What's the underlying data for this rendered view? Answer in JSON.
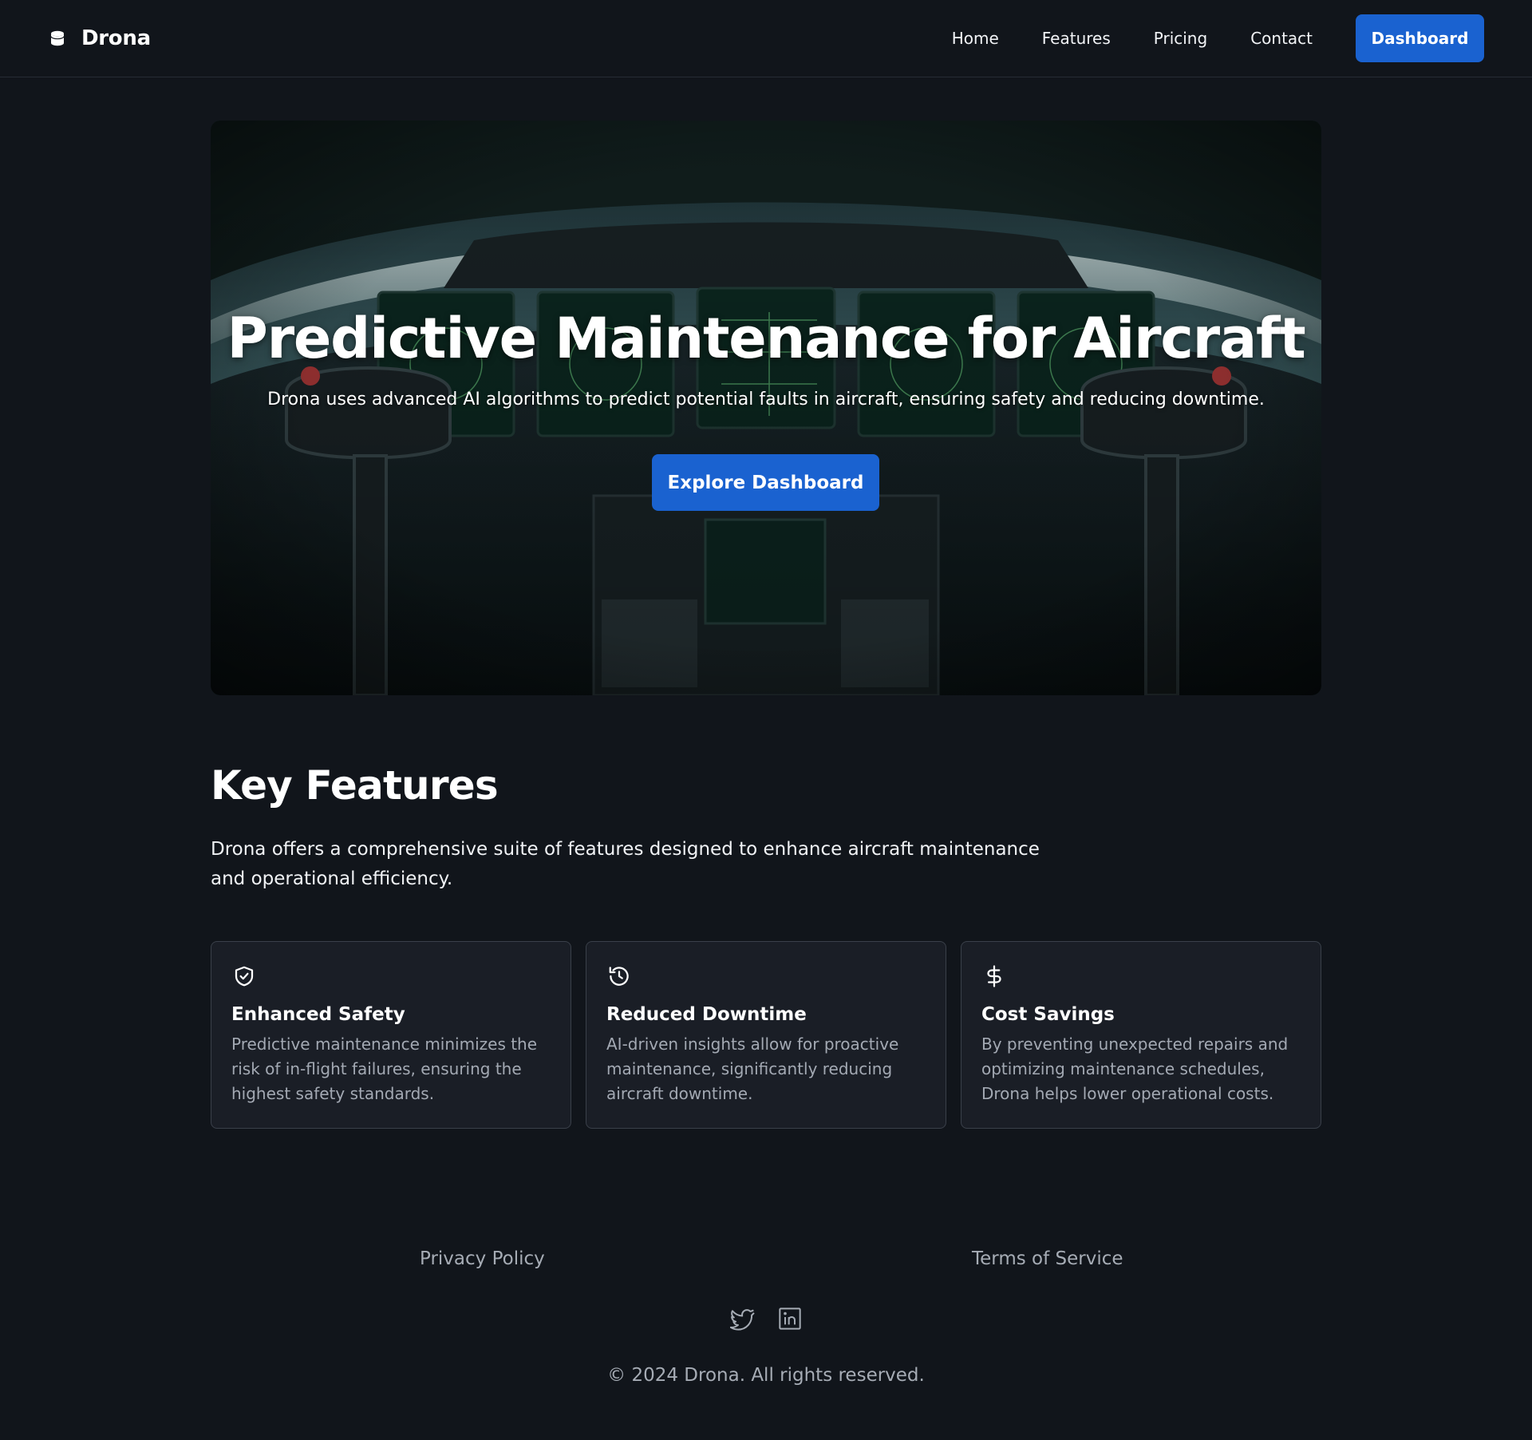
{
  "header": {
    "brand": "Drona",
    "nav": [
      "Home",
      "Features",
      "Pricing",
      "Contact"
    ],
    "cta": "Dashboard"
  },
  "hero": {
    "title": "Predictive Maintenance for Aircraft",
    "subtitle": "Drona uses advanced AI algorithms to predict potential faults in aircraft, ensuring safety and reducing downtime.",
    "button": "Explore Dashboard",
    "image_description": "aircraft-cockpit-photo"
  },
  "features": {
    "title": "Key Features",
    "description": "Drona offers a comprehensive suite of features designed to enhance aircraft maintenance and operational efficiency.",
    "cards": [
      {
        "icon": "shield-check-icon",
        "title": "Enhanced Safety",
        "text": "Predictive maintenance minimizes the risk of in-flight failures, ensuring the highest safety standards."
      },
      {
        "icon": "history-icon",
        "title": "Reduced Downtime",
        "text": "AI-driven insights allow for proactive maintenance, significantly reducing aircraft downtime."
      },
      {
        "icon": "dollar-icon",
        "title": "Cost Savings",
        "text": "By preventing unexpected repairs and optimizing maintenance schedules, Drona helps lower operational costs."
      }
    ]
  },
  "footer": {
    "links": [
      "Privacy Policy",
      "Terms of Service"
    ],
    "social": [
      "twitter-icon",
      "linkedin-icon"
    ],
    "copyright": "© 2024 Drona. All rights reserved."
  },
  "colors": {
    "background": "#11151b",
    "accent": "#1a62d0",
    "card_bg": "#1a1e26",
    "muted_text": "#a3a9b3"
  }
}
